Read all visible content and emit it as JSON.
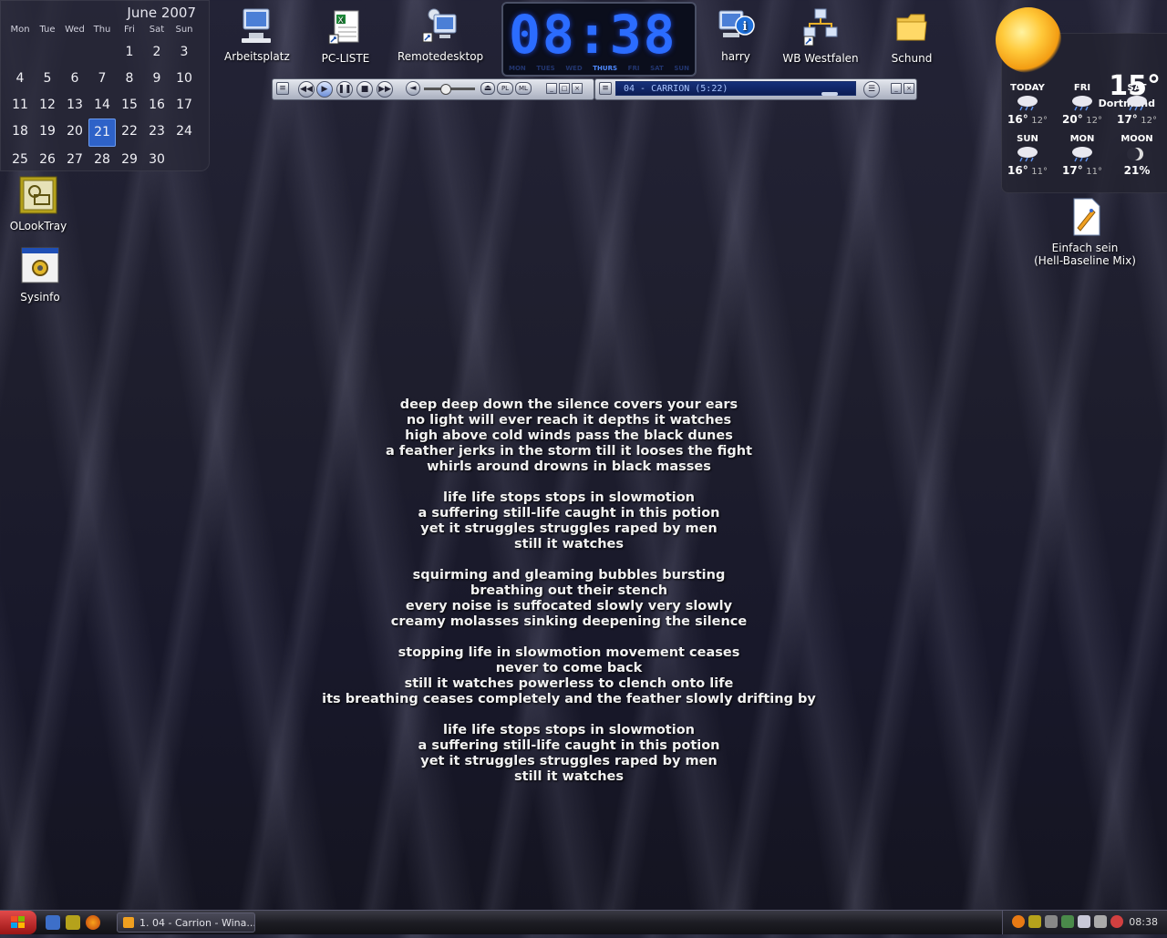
{
  "calendar": {
    "title": "June 2007",
    "weekdays": [
      "Mon",
      "Tue",
      "Wed",
      "Thu",
      "Fri",
      "Sat",
      "Sun"
    ],
    "days": [
      "",
      "",
      "",
      "",
      "1",
      "2",
      "3",
      "4",
      "5",
      "6",
      "7",
      "8",
      "9",
      "10",
      "11",
      "12",
      "13",
      "14",
      "15",
      "16",
      "17",
      "18",
      "19",
      "20",
      "21",
      "22",
      "23",
      "24",
      "25",
      "26",
      "27",
      "28",
      "29",
      "30"
    ],
    "today": "21"
  },
  "icons": {
    "arbeitsplatz": "Arbeitsplatz",
    "pcliste": "PC-LISTE",
    "remotedesktop": "Remotedesktop",
    "harry": "harry",
    "wbwestfalen": "WB Westfalen",
    "schund": "Schund",
    "olooktray": "OLookTray",
    "sysinfo": "Sysinfo",
    "einfach_line1": "Einfach sein",
    "einfach_line2": "(Hell-Baseline Mix)"
  },
  "clock": {
    "time": "08:38",
    "days": [
      "MON",
      "TUES",
      "WED",
      "THURS",
      "FRI",
      "SAT",
      "SUN"
    ],
    "active_day": "THURS"
  },
  "player": {
    "track": "04 - CARRION (5:22)",
    "pl_label": "PL",
    "ml_label": "ML"
  },
  "weather": {
    "temp": "15°",
    "city": "Dortmund",
    "days": [
      {
        "label": "TODAY",
        "hi": "16°",
        "lo": "12°"
      },
      {
        "label": "FRI",
        "hi": "20°",
        "lo": "12°"
      },
      {
        "label": "SAT",
        "hi": "17°",
        "lo": "12°"
      },
      {
        "label": "SUN",
        "hi": "16°",
        "lo": "11°"
      },
      {
        "label": "MON",
        "hi": "17°",
        "lo": "11°"
      },
      {
        "label": "MOON",
        "hi": "21%",
        "lo": ""
      }
    ]
  },
  "lyrics": [
    [
      "deep deep down the silence covers your ears",
      "no light will ever reach it depths it watches",
      "high above cold winds pass the black dunes",
      "a feather jerks in the storm till it looses the fight",
      "whirls around drowns in black masses"
    ],
    [
      "life life stops stops in slowmotion",
      "a suffering still-life caught in this potion",
      "yet it struggles struggles raped by men",
      "still it watches"
    ],
    [
      "squirming and gleaming bubbles bursting",
      "breathing out their stench",
      "every noise is suffocated slowly very slowly",
      "creamy molasses sinking deepening the silence"
    ],
    [
      "stopping life in slowmotion movement ceases",
      "never to come back",
      "still it watches powerless to clench onto life",
      "its breathing ceases completely and the feather slowly drifting by"
    ],
    [
      "life life stops stops in slowmotion",
      "a suffering still-life caught in this potion",
      "yet it struggles struggles raped by men",
      "still it watches"
    ]
  ],
  "taskbar": {
    "task_label": "1. 04 - Carrion - Wina...",
    "time": "08:38"
  },
  "colors": {
    "accent_blue": "#2b6cff",
    "today_highlight": "#2e62c8",
    "start_red": "#c62a2a"
  }
}
